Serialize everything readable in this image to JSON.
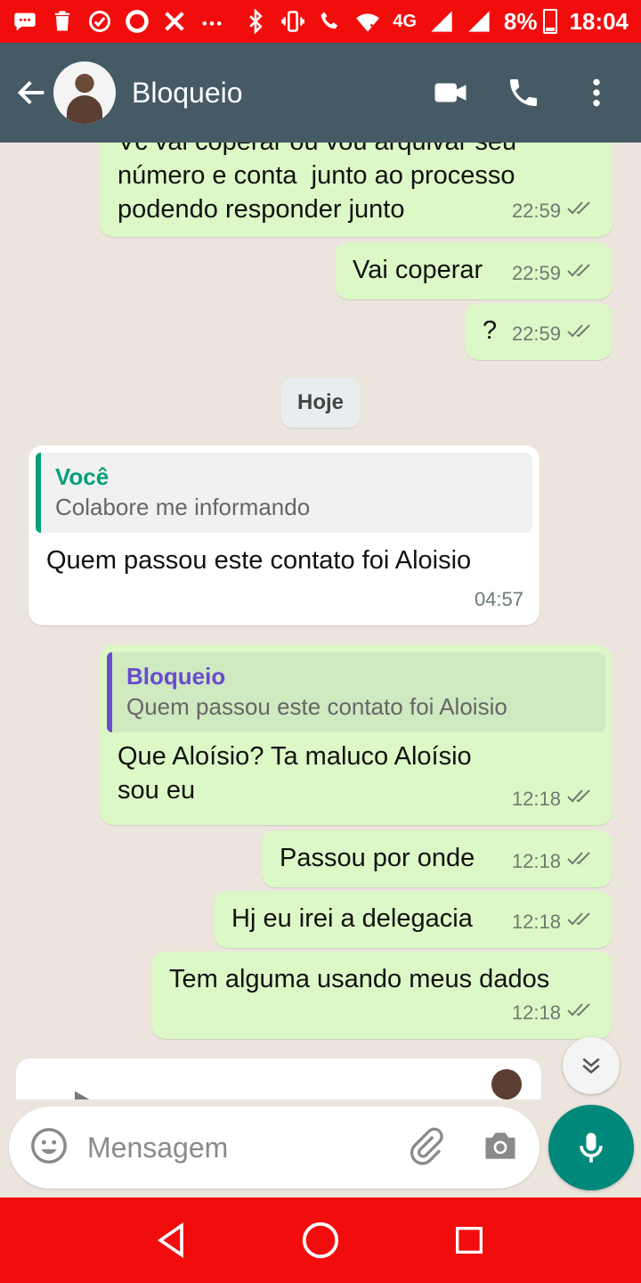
{
  "status_bar": {
    "network": "4G",
    "battery": "8%",
    "time": "18:04",
    "icons": [
      "message-icon",
      "trash-icon",
      "check-circle-icon",
      "caixa-tem-icon",
      "x-icon",
      "more-dots-icon",
      "bluetooth-icon",
      "vibrate-icon",
      "volte-call-icon",
      "wifi-off-icon",
      "signal-icon",
      "signal-icon",
      "battery-icon"
    ]
  },
  "header": {
    "contact_name": "Bloqueio",
    "icons": [
      "back-arrow-icon",
      "video-call-icon",
      "phone-call-icon",
      "overflow-menu-icon"
    ]
  },
  "messages": [
    {
      "direction": "out",
      "text": "Vc vai coperar ou vou arquivar seu\nnúmero e conta  junto ao processo\npodendo responder junto",
      "time": "22:59"
    },
    {
      "direction": "out",
      "text": "Vai coperar",
      "time": "22:59"
    },
    {
      "direction": "out",
      "text": "?",
      "time": "22:59"
    },
    {
      "direction": "in",
      "quote_author": "Você",
      "quote_text": "Colabore me informando",
      "text": "Quem passou este contato foi Aloisio",
      "time": "04:57"
    },
    {
      "direction": "out",
      "quote_author": "Bloqueio",
      "quote_text": "Quem passou este contato foi Aloisio",
      "text": "Que Aloísio? Ta maluco Aloísio\nsou eu",
      "time": "12:18"
    },
    {
      "direction": "out",
      "text": "Passou por onde",
      "time": "12:18"
    },
    {
      "direction": "out",
      "text": "Hj eu irei a delegacia",
      "time": "12:18"
    },
    {
      "direction": "out",
      "text": "Tem alguma usando meus dados",
      "time": "12:18"
    }
  ],
  "day_separator": "Hoje",
  "composer": {
    "placeholder": "Mensagem",
    "icons": [
      "emoji-icon",
      "attach-icon",
      "camera-icon",
      "mic-icon"
    ]
  },
  "colors": {
    "status_bar": "#f20d0d",
    "app_bar": "#455a64",
    "outgoing_bubble": "#dcf8c6",
    "incoming_bubble": "#ffffff",
    "mic_button": "#00897b",
    "quote_author_in": "#06a07a",
    "quote_author_out": "#6a4bd0"
  }
}
